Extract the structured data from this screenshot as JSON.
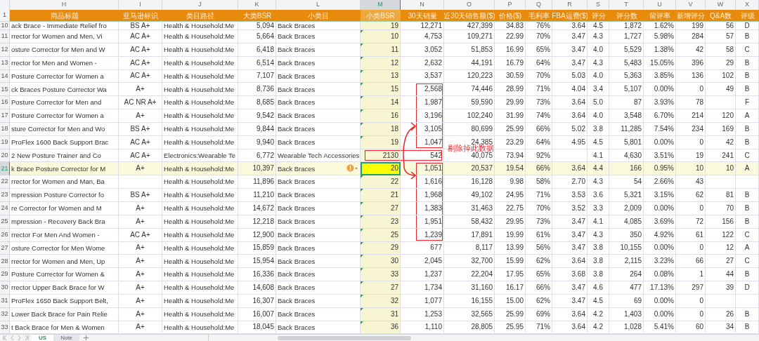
{
  "header_row": "1",
  "columns": [
    {
      "letter": "H",
      "title": "商品标题",
      "selected": false
    },
    {
      "letter": "I",
      "title": "亚马逊标识",
      "selected": false
    },
    {
      "letter": "J",
      "title": "类目路径",
      "selected": false
    },
    {
      "letter": "K",
      "title": "大类BSR",
      "selected": false
    },
    {
      "letter": "L",
      "title": "小类目",
      "selected": false
    },
    {
      "letter": "M",
      "title": "小类BSR",
      "selected": true
    },
    {
      "letter": "N",
      "title": "30天销量",
      "selected": false
    },
    {
      "letter": "O",
      "title": "近30天销售额($)",
      "selected": false
    },
    {
      "letter": "P",
      "title": "价格($)",
      "selected": false
    },
    {
      "letter": "Q",
      "title": "毛利率",
      "selected": false
    },
    {
      "letter": "R",
      "title": "FBA运费($)",
      "selected": false
    },
    {
      "letter": "S",
      "title": "评分",
      "selected": false
    },
    {
      "letter": "T",
      "title": "评分数",
      "selected": false
    },
    {
      "letter": "U",
      "title": "留评率",
      "selected": false
    },
    {
      "letter": "V",
      "title": "新增评分",
      "selected": false
    },
    {
      "letter": "W",
      "title": "Q&A数",
      "selected": false
    },
    {
      "letter": "X",
      "title": "评级",
      "selected": false
    }
  ],
  "rows": [
    {
      "row": "10",
      "selected": false,
      "flagged": false,
      "warning": false,
      "boxed": false,
      "excluded": false,
      "cells": [
        "ack Brace - Immediate Relief fro",
        "BS A+",
        "Health & Household:Me",
        "5,094",
        "Back Braces",
        "19",
        "12,271",
        "427,399",
        "34.83",
        "76%",
        "3.64",
        "4.5",
        "1,872",
        "1.62%",
        "199",
        "56",
        "D"
      ]
    },
    {
      "row": "11",
      "selected": false,
      "flagged": true,
      "warning": false,
      "boxed": false,
      "excluded": false,
      "cells": [
        "rrector for Women and Men, Vi",
        "AC A+",
        "Health & Household:Me",
        "5,664",
        "Back Braces",
        "10",
        "4,753",
        "109,271",
        "22.99",
        "70%",
        "3.47",
        "4.3",
        "1,727",
        "5.98%",
        "284",
        "57",
        "B"
      ]
    },
    {
      "row": "12",
      "selected": false,
      "flagged": true,
      "warning": false,
      "boxed": false,
      "excluded": false,
      "cells": [
        "osture Corrector for Men and W",
        "AC A+",
        "Health & Household:Me",
        "6,418",
        "Back Braces",
        "11",
        "3,052",
        "51,853",
        "16.99",
        "65%",
        "3.47",
        "4.0",
        "5,529",
        "1.38%",
        "42",
        "58",
        "C"
      ]
    },
    {
      "row": "13",
      "selected": false,
      "flagged": true,
      "warning": false,
      "boxed": false,
      "excluded": false,
      "cells": [
        "rrector for Men and Women -",
        "AC A+",
        "Health & Household:Me",
        "6,514",
        "Back Braces",
        "12",
        "2,632",
        "44,191",
        "16.79",
        "64%",
        "3.47",
        "4.3",
        "5,483",
        "15.05%",
        "396",
        "29",
        "B"
      ]
    },
    {
      "row": "14",
      "selected": false,
      "flagged": true,
      "warning": false,
      "boxed": false,
      "excluded": false,
      "cells": [
        "Posture Corrector for Women a",
        "AC A+",
        "Health & Household:Me",
        "7,107",
        "Back Braces",
        "13",
        "3,537",
        "120,223",
        "30.59",
        "70%",
        "5.03",
        "4.0",
        "5,363",
        "3.85%",
        "136",
        "102",
        "B"
      ]
    },
    {
      "row": "15",
      "selected": false,
      "flagged": true,
      "warning": false,
      "boxed": true,
      "excluded": false,
      "cells": [
        "ck Braces Posture Corrector Wa",
        "A+",
        "Health & Household:Me",
        "8,736",
        "Back Braces",
        "15",
        "2,568",
        "74,446",
        "28.99",
        "71%",
        "4.04",
        "3.4",
        "5,107",
        "0.00%",
        "0",
        "49",
        "B"
      ]
    },
    {
      "row": "16",
      "selected": false,
      "flagged": true,
      "warning": false,
      "boxed": true,
      "excluded": false,
      "cells": [
        "Posture Corrector for Men and",
        "AC NR A+",
        "Health & Household:Me",
        "8,685",
        "Back Braces",
        "14",
        "1,987",
        "59,590",
        "29.99",
        "73%",
        "3.64",
        "5.0",
        "87",
        "3.93%",
        "78",
        null,
        "F"
      ]
    },
    {
      "row": "17",
      "selected": false,
      "flagged": true,
      "warning": false,
      "boxed": true,
      "excluded": false,
      "cells": [
        "Posture Corrector for Women a",
        "A+",
        "Health & Household:Me",
        "9,542",
        "Back Braces",
        "16",
        "3,196",
        "102,240",
        "31.99",
        "74%",
        "3.64",
        "4.0",
        "3,548",
        "6.70%",
        "214",
        "120",
        "A"
      ]
    },
    {
      "row": "18",
      "selected": false,
      "flagged": true,
      "warning": false,
      "boxed": true,
      "excluded": false,
      "cells": [
        "sture Corrector for Men and Wo",
        "BS A+",
        "Health & Household:Me",
        "9,844",
        "Back Braces",
        "18",
        "3,105",
        "80,699",
        "25.99",
        "66%",
        "5.02",
        "3.8",
        "11,285",
        "7.54%",
        "234",
        "169",
        "B"
      ]
    },
    {
      "row": "19",
      "selected": false,
      "flagged": true,
      "warning": false,
      "boxed": true,
      "excluded": false,
      "cells": [
        "ProFlex 1600 Back Support Brac",
        "AC A+",
        "Health & Household:Me",
        "9,940",
        "Back Braces",
        "19",
        "1,047",
        "24,385",
        "23.29",
        "64%",
        "4.95",
        "4.5",
        "5,801",
        "0.00%",
        "0",
        "42",
        "B"
      ]
    },
    {
      "row": "20",
      "selected": false,
      "flagged": false,
      "warning": false,
      "boxed": false,
      "excluded": true,
      "cells": [
        "2 New Posture Trainer and Co",
        "AC A+",
        "Electronics:Wearable Te",
        "6,772",
        "Wearable Tech Accessories",
        "2130",
        "542",
        "40,075",
        "73.94",
        "92%",
        null,
        "4.1",
        "4,630",
        "3.51%",
        "19",
        "241",
        "C"
      ]
    },
    {
      "row": "21",
      "selected": true,
      "flagged": false,
      "warning": true,
      "boxed": true,
      "excluded": false,
      "cells": [
        "k Brace Posture Corrector for M",
        "A+",
        "Health & Household:Me",
        "10,397",
        "Back Braces",
        "20",
        "1,051",
        "20,537",
        "19.54",
        "66%",
        "3.64",
        "4.4",
        "166",
        "0.95%",
        "10",
        "10",
        "A"
      ]
    },
    {
      "row": "22",
      "selected": false,
      "flagged": true,
      "warning": false,
      "boxed": true,
      "excluded": false,
      "cells": [
        "rrector for Women and Man, Ba",
        null,
        "Health & Household:Me",
        "11,896",
        "Back Braces",
        "22",
        "1,616",
        "16,128",
        "9.98",
        "58%",
        "2.70",
        "4.3",
        "54",
        "2.66%",
        "43",
        null,
        null
      ]
    },
    {
      "row": "23",
      "selected": false,
      "flagged": true,
      "warning": false,
      "boxed": true,
      "excluded": false,
      "cells": [
        "mpression Posture Corrector fo",
        "BS A+",
        "Health & Household:Me",
        "11,210",
        "Back Braces",
        "21",
        "1,968",
        "49,102",
        "24.95",
        "71%",
        "3.53",
        "3.6",
        "5,321",
        "3.15%",
        "62",
        "81",
        "B"
      ]
    },
    {
      "row": "24",
      "selected": false,
      "flagged": true,
      "warning": false,
      "boxed": true,
      "excluded": false,
      "cells": [
        "re Corrector for Women and M",
        "A+",
        "Health & Household:Me",
        "14,672",
        "Back Braces",
        "27",
        "1,383",
        "31,463",
        "22.75",
        "70%",
        "3.52",
        "3.3",
        "2,009",
        "0.00%",
        "0",
        "70",
        "B"
      ]
    },
    {
      "row": "25",
      "selected": false,
      "flagged": true,
      "warning": false,
      "boxed": true,
      "excluded": false,
      "cells": [
        "mpression - Recovery Back Bra",
        "A+",
        "Health & Household:Me",
        "12,218",
        "Back Braces",
        "23",
        "1,951",
        "58,432",
        "29.95",
        "73%",
        "3.47",
        "4.1",
        "4,085",
        "3.69%",
        "72",
        "156",
        "B"
      ]
    },
    {
      "row": "26",
      "selected": false,
      "flagged": true,
      "warning": false,
      "boxed": true,
      "excluded": false,
      "cells": [
        "rrector For Men And Women -",
        "AC A+",
        "Health & Household:Me",
        "12,900",
        "Back Braces",
        "25",
        "1,239",
        "17,891",
        "19.99",
        "61%",
        "3.47",
        "4.3",
        "350",
        "4.92%",
        "61",
        "122",
        "C"
      ]
    },
    {
      "row": "27",
      "selected": false,
      "flagged": true,
      "warning": false,
      "boxed": false,
      "excluded": false,
      "cells": [
        "osture Corrector for Men Wome",
        "A+",
        "Health & Household:Me",
        "15,859",
        "Back Braces",
        "29",
        "677",
        "8,117",
        "13.99",
        "56%",
        "3.47",
        "3.8",
        "10,155",
        "0.00%",
        "0",
        "12",
        "A"
      ]
    },
    {
      "row": "28",
      "selected": false,
      "flagged": true,
      "warning": false,
      "boxed": false,
      "excluded": false,
      "cells": [
        "rrector for Women and Men, Up",
        "A+",
        "Health & Household:Me",
        "15,954",
        "Back Braces",
        "30",
        "2,045",
        "32,700",
        "15.99",
        "62%",
        "3.64",
        "3.8",
        "2,115",
        "3.23%",
        "66",
        "27",
        "C"
      ]
    },
    {
      "row": "29",
      "selected": false,
      "flagged": true,
      "warning": false,
      "boxed": false,
      "excluded": false,
      "cells": [
        "Posture Corrector for Women &",
        "A+",
        "Health & Household:Me",
        "16,336",
        "Back Braces",
        "33",
        "1,237",
        "22,204",
        "17.95",
        "65%",
        "3.68",
        "3.8",
        "264",
        "0.08%",
        "1",
        "44",
        "B"
      ]
    },
    {
      "row": "30",
      "selected": false,
      "flagged": true,
      "warning": false,
      "boxed": false,
      "excluded": false,
      "cells": [
        "rrector Upper Back Brace for W",
        "A+",
        "Health & Household:Me",
        "14,608",
        "Back Braces",
        "27",
        "1,734",
        "31,160",
        "16.17",
        "66%",
        "3.47",
        "4.6",
        "477",
        "17.13%",
        "297",
        "39",
        "D"
      ]
    },
    {
      "row": "31",
      "selected": false,
      "flagged": true,
      "warning": false,
      "boxed": false,
      "excluded": false,
      "cells": [
        "ProFlex 1650 Back Support Belt,",
        "A+",
        "Health & Household:Me",
        "16,307",
        "Back Braces",
        "32",
        "1,077",
        "16,155",
        "15.00",
        "62%",
        "3.47",
        "4.5",
        "69",
        "0.00%",
        "0",
        null,
        null
      ]
    },
    {
      "row": "32",
      "selected": false,
      "flagged": true,
      "warning": false,
      "boxed": false,
      "excluded": false,
      "cells": [
        "Lower Back Brace for Pain Relie",
        "A+",
        "Health & Household:Me",
        "16,007",
        "Back Braces",
        "31",
        "1,253",
        "32,565",
        "25.99",
        "69%",
        "3.64",
        "4.2",
        "1,403",
        "0.00%",
        "0",
        "26",
        "B"
      ]
    },
    {
      "row": "33",
      "selected": false,
      "flagged": true,
      "warning": false,
      "boxed": false,
      "excluded": false,
      "cells": [
        "t Back Brace for Men & Women",
        "A+",
        "Health & Household:Me",
        "18,045",
        "Back Braces",
        "36",
        "1,110",
        "28,805",
        "25.95",
        "71%",
        "3.64",
        "4.2",
        "1,028",
        "5.41%",
        "60",
        "34",
        "B"
      ]
    }
  ],
  "annotation": "剔除掉此数据",
  "sheets": [
    {
      "label": "US",
      "selected": true
    },
    {
      "label": "Note",
      "selected": false
    }
  ]
}
